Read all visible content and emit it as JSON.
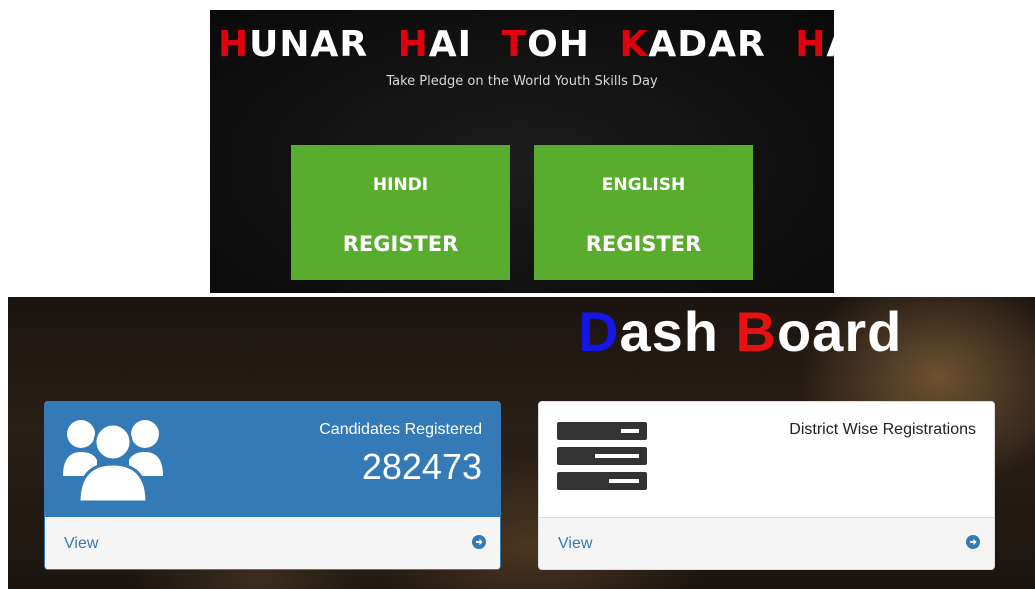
{
  "banner": {
    "title_words": [
      {
        "cap": "H",
        "rest": "UNAR"
      },
      {
        "cap": "H",
        "rest": "AI"
      },
      {
        "cap": "T",
        "rest": "OH"
      },
      {
        "cap": "K",
        "rest": "ADAR"
      },
      {
        "cap": "H",
        "rest": "AI"
      }
    ],
    "subtitle": "Take Pledge on the World Youth Skills Day",
    "buttons": [
      {
        "language": "HINDI",
        "action": "REGISTER"
      },
      {
        "language": "ENGLISH",
        "action": "REGISTER"
      }
    ]
  },
  "dashboard": {
    "title_d": "D",
    "title_rest1": "ash ",
    "title_b": "B",
    "title_rest2": "oard",
    "panels": [
      {
        "label": "Candidates Registered",
        "count": "282473",
        "view": "View",
        "icon": "users-icon"
      },
      {
        "label": "District Wise Registrations",
        "count": "",
        "view": "View",
        "icon": "server-icon"
      }
    ]
  },
  "colors": {
    "accent_red": "#e1000e",
    "register_green": "#5aac2f",
    "panel_blue": "#337ab7",
    "title_blue": "#1515e6",
    "title_red": "#e81010"
  }
}
